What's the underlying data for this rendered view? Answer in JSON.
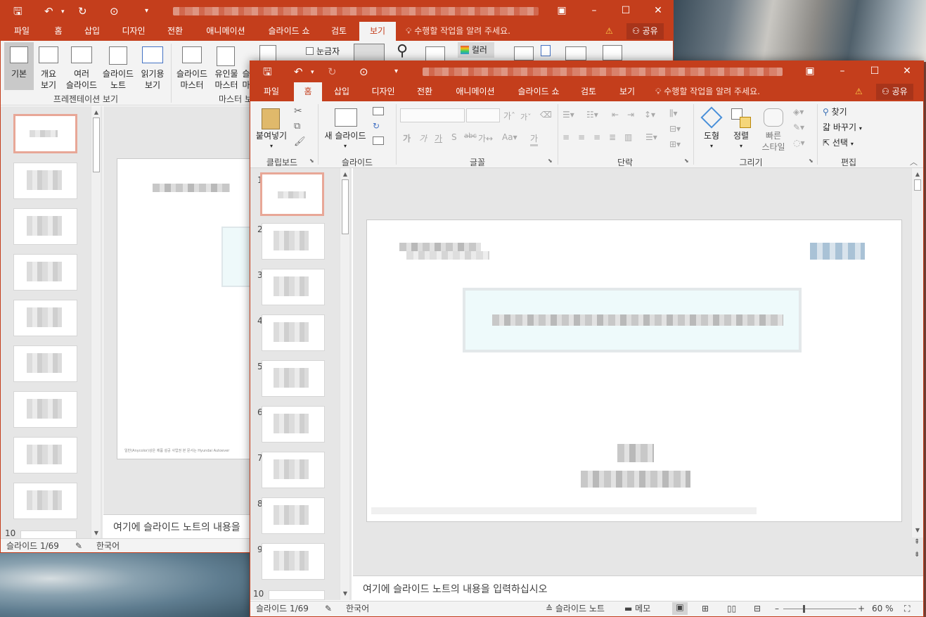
{
  "back_window": {
    "tabs": [
      "파일",
      "홈",
      "삽입",
      "디자인",
      "전환",
      "애니메이션",
      "슬라이드 쇼",
      "검토",
      "보기"
    ],
    "active_tab": "보기",
    "tell_me": "수행할 작업을 알려 주세요.",
    "share": "공유",
    "ribbon": {
      "basic": "기본",
      "outline_l1": "개요",
      "outline_l2": "보기",
      "sorter_l1": "여러",
      "sorter_l2": "슬라이드",
      "notes_l1": "슬라이드",
      "notes_l2": "노트",
      "reading_l1": "읽기용",
      "reading_l2": "보기",
      "slide_master_l1": "슬라이드",
      "slide_master_l2": "마스터",
      "handout_l1": "유인물",
      "handout_l2": "마스터",
      "notes_master_l1": "슬",
      "notes_master_l2": "마",
      "ruler": "눈금자",
      "color": "컬러",
      "group_presentation_views": "프레젠테이션 보기",
      "group_master_views": "마스터 보"
    },
    "thumb_last_number": "10",
    "notes_placeholder": "여기에 슬라이드 노트의 내용을",
    "footer_tiny": "일반(Anycolor)상은 제품 설공 사업권 본 문서는 Hyundai Autoever",
    "status": {
      "slide": "슬라이드 1/69",
      "lang": "한국어"
    }
  },
  "front_window": {
    "tabs": [
      "파일",
      "홈",
      "삽입",
      "디자인",
      "전환",
      "애니메이션",
      "슬라이드 쇼",
      "검토",
      "보기"
    ],
    "active_tab": "홈",
    "tell_me": "수행할 작업을 알려 주세요.",
    "share": "공유",
    "ribbon": {
      "paste": "붙여넣기",
      "new_slide": "새 슬라이드",
      "shapes": "도형",
      "arrange": "정렬",
      "quick_styles_l1": "빠른",
      "quick_styles_l2": "스타일",
      "find": "찾기",
      "replace": "바꾸기",
      "select": "선택",
      "group_clipboard": "클립보드",
      "group_slides": "슬라이드",
      "group_font": "글꼴",
      "group_paragraph": "단락",
      "group_drawing": "그리기",
      "group_editing": "편집"
    },
    "thumb_numbers": [
      "1",
      "2",
      "3",
      "4",
      "5",
      "6",
      "7",
      "8",
      "9",
      "10"
    ],
    "notes_placeholder": "여기에 슬라이드 노트의 내용을 입력하십시오",
    "status": {
      "slide": "슬라이드 1/69",
      "lang": "한국어",
      "notes": "슬라이드 노트",
      "comments": "메모",
      "zoom": "60 %"
    }
  }
}
